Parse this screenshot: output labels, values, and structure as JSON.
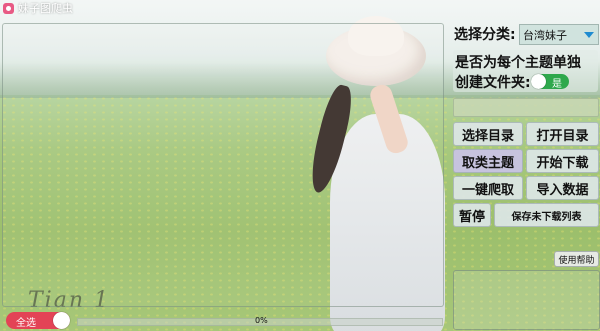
{
  "window": {
    "title": "妹子图爬虫"
  },
  "photo": {
    "signature": "Tian 1"
  },
  "category": {
    "label": "选择分类:",
    "selected": "台湾妹子"
  },
  "folder_option": {
    "line1": "是否为每个主题单独",
    "line2": "创建文件夹:",
    "toggle_text": "是",
    "enabled": true
  },
  "directory_path": {
    "value": ""
  },
  "buttons": {
    "select_dir": "选择目录",
    "open_dir": "打开目录",
    "fetch_topics": "取类主题",
    "start_download": "开始下载",
    "one_click_crawl": "一键爬取",
    "import_data": "导入数据",
    "pause": "暂停",
    "save_undownloaded": "保存未下载列表",
    "help": "使用帮助"
  },
  "select_all": {
    "label": "全选",
    "enabled": true
  },
  "progress": {
    "value": 0,
    "text": "0%"
  },
  "colors": {
    "toggle_on": "#2ea84c",
    "select_all_toggle": "#e34356",
    "dropdown_arrow": "#1f8bd0",
    "purple_button": "#c8c3e4"
  }
}
